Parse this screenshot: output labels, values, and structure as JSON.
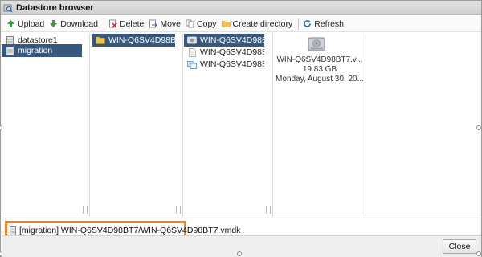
{
  "window": {
    "title": "Datastore browser",
    "title_icon": "datastore-browser-icon"
  },
  "toolbar": {
    "upload": "Upload",
    "download": "Download",
    "delete": "Delete",
    "move": "Move",
    "copy": "Copy",
    "create_directory": "Create directory",
    "refresh": "Refresh"
  },
  "datastores": [
    {
      "label": "datastore1",
      "selected": false
    },
    {
      "label": "migration",
      "selected": true
    }
  ],
  "folders": [
    {
      "label": "WIN-Q6SV4D98BT7",
      "selected": true
    }
  ],
  "files": [
    {
      "label": "WIN-Q6SV4D98BT...",
      "icon": "vmdk-disk-icon",
      "selected": true
    },
    {
      "label": "WIN-Q6SV4D98BT...",
      "icon": "document-icon",
      "selected": false
    },
    {
      "label": "WIN-Q6SV4D98BT...",
      "icon": "vm-config-icon",
      "selected": false
    }
  ],
  "details": {
    "icon": "hard-disk-icon",
    "name": "WIN-Q6SV4D98BT7.v...",
    "size": "19.83 GB",
    "modified": "Monday, August 30, 20..."
  },
  "path": {
    "text": "[migration] WIN-Q6SV4D98BT7/WIN-Q6SV4D98BT7.vmdk"
  },
  "footer": {
    "close": "Close"
  },
  "colors": {
    "selection": "#36587e",
    "highlight_border": "#e8862a"
  }
}
